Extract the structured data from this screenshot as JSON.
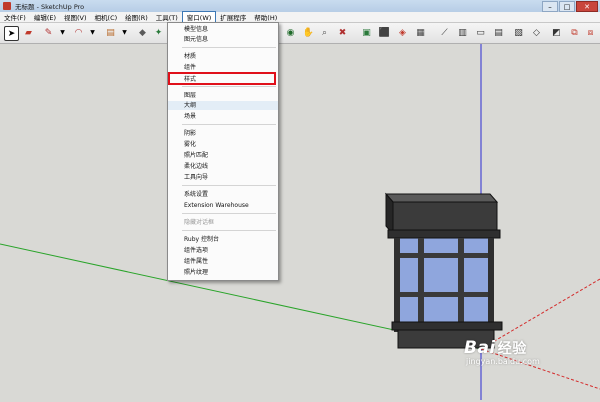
{
  "window": {
    "title": "无标题 - SketchUp Pro",
    "buttons": [
      "–",
      "□",
      "✕"
    ]
  },
  "menubar": {
    "items": [
      "文件(F)",
      "编辑(E)",
      "视图(V)",
      "相机(C)",
      "绘图(R)",
      "工具(T)",
      "窗口(W)",
      "扩展程序",
      "帮助(H)"
    ],
    "active_index": 6
  },
  "window_menu": {
    "items": [
      {
        "label": "模型信息"
      },
      {
        "label": "图元信息"
      },
      {
        "label": "材质"
      },
      {
        "label": "组件"
      },
      {
        "label": "样式"
      },
      {
        "label": "图层"
      },
      {
        "label": "大纲"
      },
      {
        "label": "场景"
      },
      {
        "label": "阴影"
      },
      {
        "label": "雾化"
      },
      {
        "label": "照片匹配"
      },
      {
        "label": "柔化边线"
      },
      {
        "label": "工具向导"
      },
      {
        "label": "系统设置"
      },
      {
        "label": "Extension Warehouse"
      },
      {
        "label": "隐藏对话框"
      },
      {
        "label": "Ruby 控制台"
      },
      {
        "label": "组件选项"
      },
      {
        "label": "组件属性"
      },
      {
        "label": "照片纹理"
      }
    ],
    "highlighted": "大纲",
    "disabled": "隐藏对话框",
    "annotated": "样式"
  },
  "watermark": {
    "brand": "Bai",
    "brand_cn": "经验",
    "url": "jingyan.baidu.com"
  },
  "colors": {
    "annotation": "#e0101a",
    "red_axis": "#d42b2b",
    "green_axis": "#2aa42a",
    "blue_axis": "#2b2bd4",
    "glass": "#8fa6dd",
    "frame": "#3a3a3a"
  }
}
